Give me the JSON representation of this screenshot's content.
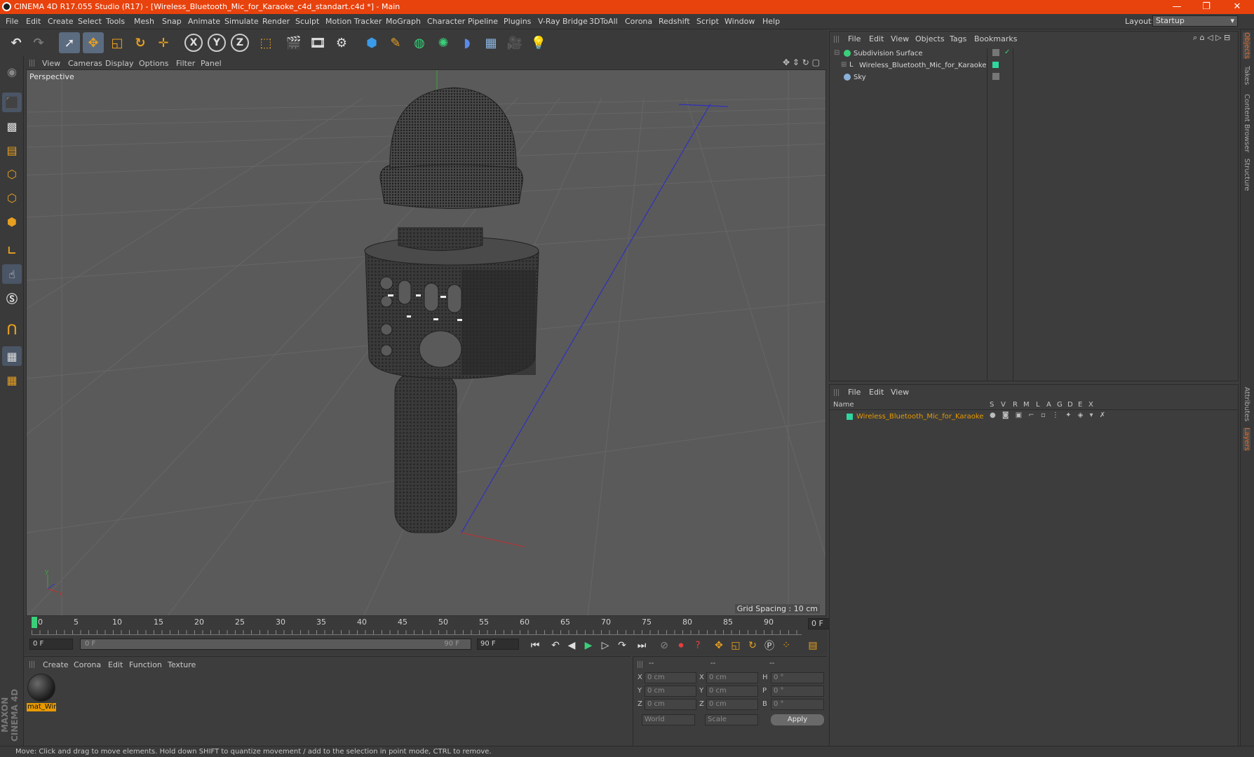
{
  "titlebar": {
    "title": "CINEMA 4D R17.055 Studio (R17) - [Wireless_Bluetooth_Mic_for_Karaoke_c4d_standart.c4d *] - Main",
    "minimize": "—",
    "restore": "❐",
    "close": "✕"
  },
  "menu": [
    "File",
    "Edit",
    "Create",
    "Select",
    "Tools",
    "Mesh",
    "Snap",
    "Animate",
    "Simulate",
    "Render",
    "Sculpt",
    "Motion Tracker",
    "MoGraph",
    "Character",
    "Pipeline",
    "Plugins",
    "V-Ray Bridge",
    "3DToAll",
    "Corona",
    "Redshift",
    "Script",
    "Window",
    "Help"
  ],
  "layout": {
    "label": "Layout:",
    "value": "Startup"
  },
  "viewport": {
    "menu": [
      "View",
      "Cameras",
      "Display",
      "Options",
      "Filter",
      "Panel"
    ],
    "label": "Perspective",
    "grid_spacing": "Grid Spacing : 10 cm"
  },
  "timeline": {
    "ticks": [
      "0",
      "5",
      "10",
      "15",
      "20",
      "25",
      "30",
      "35",
      "40",
      "45",
      "50",
      "55",
      "60",
      "65",
      "70",
      "75",
      "80",
      "85",
      "90"
    ],
    "current_frame": "0 F"
  },
  "transport": {
    "start": "0 F",
    "range_start": "0 F",
    "range_end": "90 F",
    "end": "90 F"
  },
  "materials": {
    "menu": [
      "Create",
      "Corona",
      "Edit",
      "Function",
      "Texture"
    ],
    "items": [
      {
        "name": "mat_Wir"
      }
    ]
  },
  "coords": {
    "headers": [
      "--",
      "--",
      "--"
    ],
    "rows": [
      {
        "a": "X",
        "av": "0 cm",
        "b": "X",
        "bv": "0 cm",
        "c": "H",
        "cv": "0 °"
      },
      {
        "a": "Y",
        "av": "0 cm",
        "b": "Y",
        "bv": "0 cm",
        "c": "P",
        "cv": "0 °"
      },
      {
        "a": "Z",
        "av": "0 cm",
        "b": "Z",
        "bv": "0 cm",
        "c": "B",
        "cv": "0 °"
      }
    ],
    "world": "World",
    "scale": "Scale",
    "apply": "Apply"
  },
  "objects": {
    "menu": [
      "File",
      "Edit",
      "View",
      "Objects",
      "Tags",
      "Bookmarks"
    ],
    "items": [
      {
        "name": "Subdivision Surface"
      },
      {
        "name": "Wireless_Bluetooth_Mic_for_Karaoke"
      },
      {
        "name": "Sky"
      }
    ]
  },
  "layers": {
    "menu": [
      "File",
      "Edit",
      "View"
    ],
    "header": {
      "name": "Name",
      "cols": [
        "S",
        "V",
        "R",
        "M",
        "L",
        "A",
        "G",
        "D",
        "E",
        "X"
      ]
    },
    "items": [
      {
        "name": "Wireless_Bluetooth_Mic_for_Karaoke",
        "color": "#2fd6a0"
      }
    ]
  },
  "right_tabs": [
    "Objects",
    "Takes",
    "Content Browser",
    "Structure",
    "Attributes",
    "Layers"
  ],
  "status": "Move: Click and drag to move elements. Hold down SHIFT to quantize movement / add to the selection in point mode, CTRL to remove.",
  "brand": "MAXON CINEMA 4D",
  "colors": {
    "title": "#e8420d",
    "accent": "#e89a00",
    "layer": "#2fd6a0"
  }
}
